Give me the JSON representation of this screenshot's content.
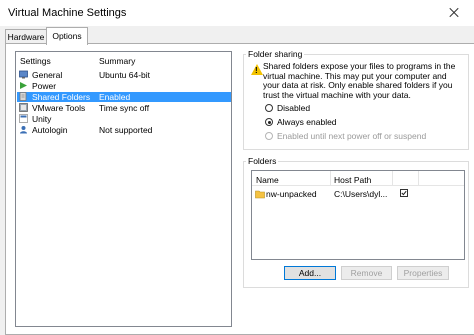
{
  "window": {
    "title": "Virtual Machine Settings"
  },
  "tabs": [
    {
      "label": "Hardware"
    },
    {
      "label": "Options"
    }
  ],
  "settings": {
    "columns": {
      "settings": "Settings",
      "summary": "Summary"
    },
    "rows": [
      {
        "name": "General",
        "summary": "Ubuntu 64-bit",
        "icon": "general-icon"
      },
      {
        "name": "Power",
        "summary": "",
        "icon": "power-icon"
      },
      {
        "name": "Shared Folders",
        "summary": "Enabled",
        "icon": "shared-folders-icon",
        "selected": true
      },
      {
        "name": "VMware Tools",
        "summary": "Time sync off",
        "icon": "vmware-tools-icon"
      },
      {
        "name": "Unity",
        "summary": "",
        "icon": "unity-icon"
      },
      {
        "name": "Autologin",
        "summary": "Not supported",
        "icon": "autologin-icon"
      }
    ]
  },
  "folder_sharing": {
    "title": "Folder sharing",
    "description": "Shared folders expose your files to programs in the virtual machine. This may put your computer and your data at risk. Only enable shared folders if you trust the virtual machine with your data.",
    "options": [
      {
        "label": "Disabled",
        "checked": false,
        "enabled": true
      },
      {
        "label": "Always enabled",
        "checked": true,
        "enabled": true
      },
      {
        "label": "Enabled until next power off or suspend",
        "checked": false,
        "enabled": false
      }
    ]
  },
  "folders": {
    "title": "Folders",
    "columns": {
      "name": "Name",
      "host_path": "Host Path"
    },
    "rows": [
      {
        "name": "nw-unpacked",
        "host_path": "C:\\Users\\dyl...",
        "checked": true
      }
    ],
    "buttons": {
      "add": "Add...",
      "remove": "Remove",
      "properties": "Properties"
    }
  },
  "colors": {
    "selection": "#3399ff",
    "warning": "#f2c200",
    "folder": "#f5c242"
  }
}
